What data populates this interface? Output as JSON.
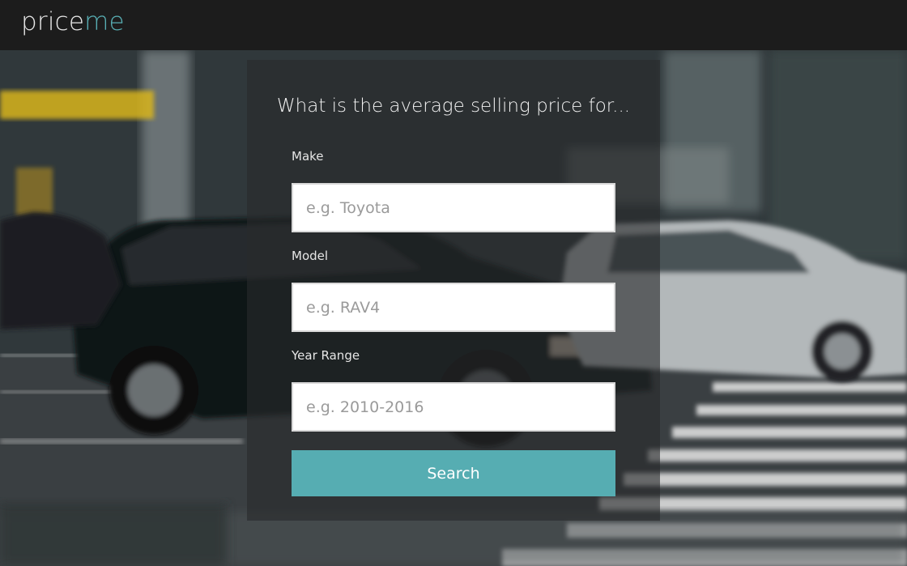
{
  "brand": {
    "part1": "price",
    "part2": "me",
    "color_primary": "#e8e8e8",
    "color_accent": "#58aeb3"
  },
  "form": {
    "heading": "What is the average selling price for...",
    "make": {
      "label": "Make",
      "placeholder": "e.g. Toyota",
      "value": ""
    },
    "model": {
      "label": "Model",
      "placeholder": "e.g. RAV4",
      "value": ""
    },
    "year": {
      "label": "Year Range",
      "placeholder": "e.g. 2010-2016",
      "value": ""
    },
    "submit_label": "Search",
    "accent_color": "#56adb2"
  }
}
